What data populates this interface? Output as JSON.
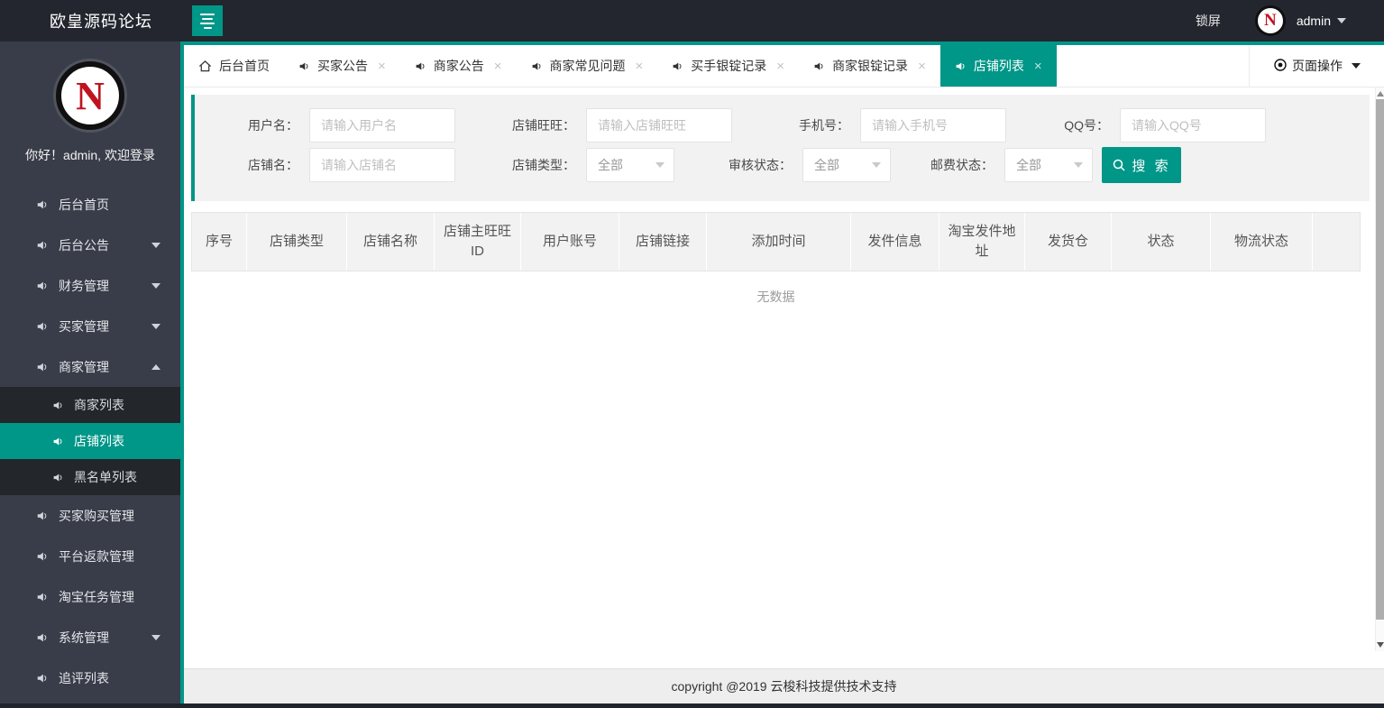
{
  "colors": {
    "accent": "#009688",
    "navbar_bg": "#23262e",
    "sidebar_bg": "#393d49",
    "submenu_bg": "#23262b"
  },
  "navbar": {
    "brand": "欧皇源码论坛",
    "lock_label": "锁屏",
    "username": "admin",
    "avatar_letter": "N"
  },
  "sidebar": {
    "logo_letter": "N",
    "greeting": "你好！admin, 欢迎登录",
    "items": [
      {
        "label": "后台首页",
        "has_children": false
      },
      {
        "label": "后台公告",
        "has_children": true,
        "expanded": false
      },
      {
        "label": "财务管理",
        "has_children": true,
        "expanded": false
      },
      {
        "label": "买家管理",
        "has_children": true,
        "expanded": false
      },
      {
        "label": "商家管理",
        "has_children": true,
        "expanded": true,
        "children": [
          {
            "label": "商家列表",
            "active": false
          },
          {
            "label": "店铺列表",
            "active": true
          },
          {
            "label": "黑名单列表",
            "active": false
          }
        ]
      },
      {
        "label": "买家购买管理",
        "has_children": false
      },
      {
        "label": "平台返款管理",
        "has_children": false
      },
      {
        "label": "淘宝任务管理",
        "has_children": false
      },
      {
        "label": "系统管理",
        "has_children": true,
        "expanded": false
      },
      {
        "label": "追评列表",
        "has_children": false
      }
    ]
  },
  "tabs": {
    "items": [
      {
        "label": "后台首页",
        "icon": "home",
        "closable": false,
        "active": false
      },
      {
        "label": "买家公告",
        "icon": "speaker",
        "closable": true,
        "active": false
      },
      {
        "label": "商家公告",
        "icon": "speaker",
        "closable": true,
        "active": false
      },
      {
        "label": "商家常见问题",
        "icon": "speaker",
        "closable": true,
        "active": false
      },
      {
        "label": "买手银锭记录",
        "icon": "speaker",
        "closable": true,
        "active": false
      },
      {
        "label": "商家银锭记录",
        "icon": "speaker",
        "closable": true,
        "active": false
      },
      {
        "label": "店铺列表",
        "icon": "speaker",
        "closable": true,
        "active": true
      }
    ],
    "close_glyph": "×",
    "page_ops_label": "页面操作"
  },
  "search_form": {
    "rows": [
      [
        {
          "label": "用户名：",
          "type": "input",
          "placeholder": "请输入用户名",
          "value": ""
        },
        {
          "label": "店铺旺旺：",
          "type": "input",
          "placeholder": "请输入店铺旺旺",
          "value": ""
        },
        {
          "label": "手机号：",
          "type": "input",
          "placeholder": "请输入手机号",
          "value": ""
        },
        {
          "label": "QQ号：",
          "type": "input",
          "placeholder": "请输入QQ号",
          "value": ""
        }
      ],
      [
        {
          "label": "店铺名：",
          "type": "input",
          "placeholder": "请输入店铺名",
          "value": ""
        },
        {
          "label": "店铺类型：",
          "type": "select",
          "value": "全部"
        },
        {
          "label": "审核状态：",
          "type": "select",
          "value": "全部"
        },
        {
          "label": "邮费状态：",
          "type": "select",
          "value": "全部"
        }
      ]
    ],
    "search_button": "搜 索"
  },
  "table": {
    "columns": [
      "序号",
      "店铺类型",
      "店铺名称",
      "店铺主旺旺ID",
      "用户账号",
      "店铺链接",
      "添加时间",
      "发件信息",
      "淘宝发件地址",
      "发货仓",
      "状态",
      "物流状态",
      ""
    ],
    "empty_text": "无数据"
  },
  "footer": {
    "copyright": "copyright @2019 云梭科技提供技术支持"
  }
}
